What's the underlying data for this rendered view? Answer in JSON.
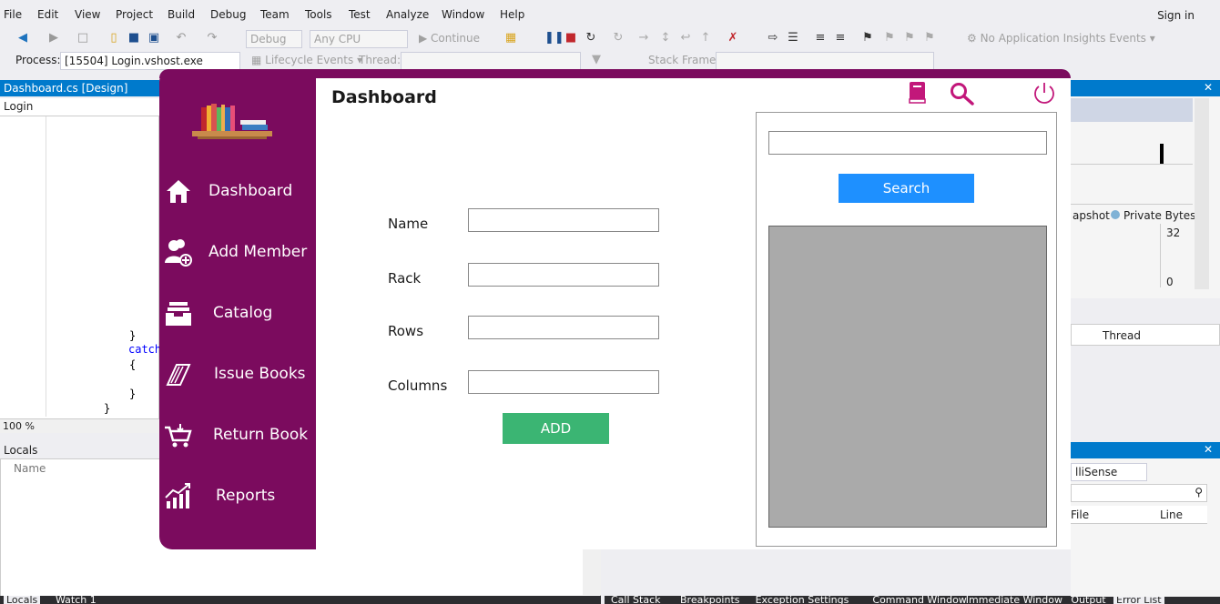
{
  "ide": {
    "menu": [
      "File",
      "Edit",
      "View",
      "Project",
      "Build",
      "Debug",
      "Team",
      "Tools",
      "Test",
      "Analyze",
      "Window",
      "Help"
    ],
    "signin": "Sign in",
    "toolbar": {
      "config": "Debug",
      "platform": "Any CPU",
      "continue": "Continue",
      "insights": "No Application Insights Events"
    },
    "process_label": "Process:",
    "process_value": "[15504] Login.vshost.exe",
    "lifecycle": "Lifecycle Events",
    "thread_label": "Thread:",
    "stackframe_label": "Stack Frame:",
    "doc_tab": "Dashboard.cs [Design]",
    "editor_combo": "Login",
    "code": [
      "}",
      "catch",
      "{",
      "}",
      "}"
    ],
    "zoom": "100 %",
    "locals_title": "Locals",
    "locals_col": "Name",
    "right": {
      "snapshot": "apshot",
      "private_bytes": "Private Bytes",
      "val_32": "32",
      "val_0": "0",
      "thread": "Thread",
      "intellisense": "lliSense",
      "file": "File",
      "line": "Line"
    },
    "bottom_tabs_left": [
      "Locals",
      "Watch 1"
    ],
    "bottom_tabs_right": [
      "Call Stack",
      "Breakpoints",
      "Exception Settings",
      "Command Window",
      "Immediate Window",
      "Output",
      "Error List"
    ]
  },
  "app": {
    "title": "Dashboard",
    "nav": [
      {
        "label": "Dashboard",
        "icon": "home-icon"
      },
      {
        "label": "Add Member",
        "icon": "add-member-icon"
      },
      {
        "label": "Catalog",
        "icon": "catalog-icon"
      },
      {
        "label": "Issue Books",
        "icon": "issue-books-icon"
      },
      {
        "label": "Return Book",
        "icon": "cart-icon"
      },
      {
        "label": "Reports",
        "icon": "chart-icon"
      }
    ],
    "form": {
      "name_label": "Name",
      "rack_label": "Rack",
      "rows_label": "Rows",
      "columns_label": "Columns",
      "add_label": "ADD"
    },
    "search_label": "Search",
    "colors": {
      "sidebar": "#7b0b5e",
      "add": "#3bb573",
      "search": "#1e90ff",
      "accent_icon": "#c2177a"
    }
  }
}
